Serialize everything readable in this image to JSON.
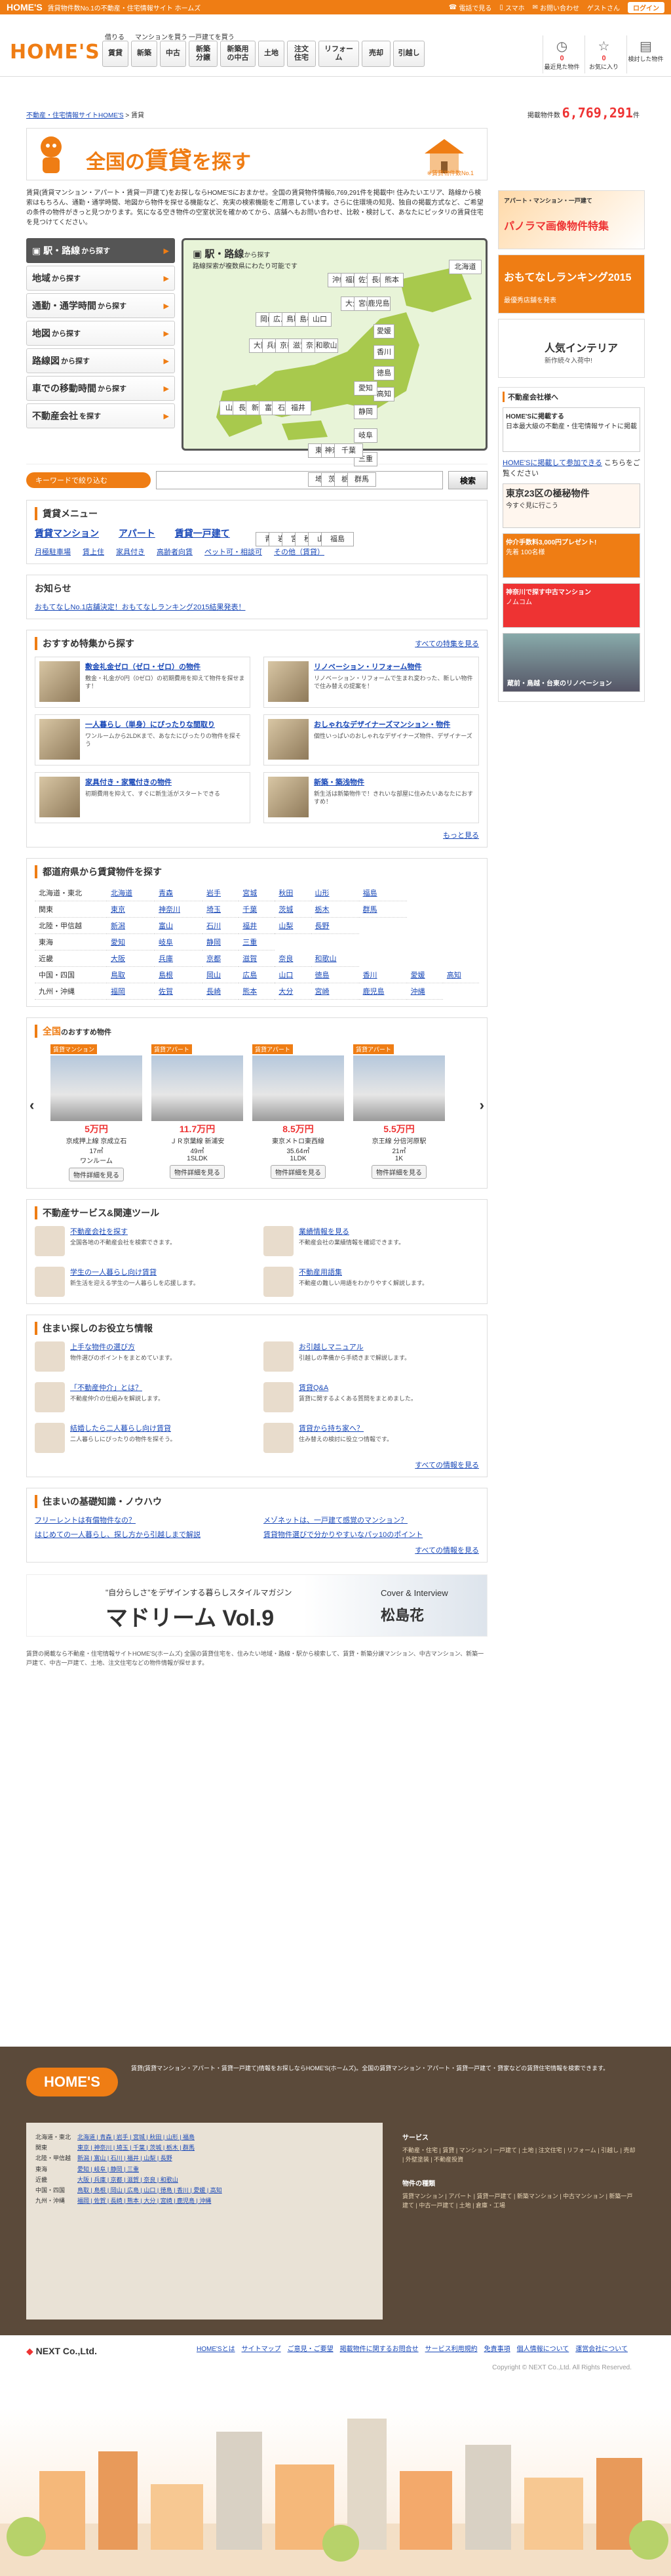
{
  "topbar": {
    "brand": "HOME'S",
    "tagline": "賃貸物件数No.1の不動産・住宅情報サイト ホームズ",
    "links": [
      "電話で見る",
      "スマホ",
      "お問い合わせ",
      "ゲストさん"
    ],
    "login": "ログイン"
  },
  "header": {
    "logo": "HOME'S",
    "group_rent": "借りる",
    "group_buy_mansion": "マンションを買う",
    "group_buy_house": "一戸建てを買う",
    "nav": [
      "賃貸",
      "新築",
      "中古",
      "新築分譲",
      "新築用の中古",
      "土地",
      "注文住宅",
      "リフォーム",
      "売却",
      "引越し"
    ],
    "icons": [
      {
        "icon": "clock-icon",
        "count": "0",
        "label": "最近見た物件"
      },
      {
        "icon": "star-icon",
        "count": "0",
        "label": "お気に入り"
      },
      {
        "icon": "memo-icon",
        "count": "",
        "label": "検討した物件"
      }
    ]
  },
  "breadcrumb": [
    "不動産・住宅情報サイトHOME'S",
    "賃貸"
  ],
  "counter": {
    "label": "掲載物件数",
    "value": "6,769,291",
    "unit": "件"
  },
  "hero": {
    "title_a": "全国の",
    "title_b": "賃貸",
    "title_c": "を探す",
    "caption": "※賃貸物件数No.1"
  },
  "intro": "賃貸(賃貸マンション・アパート・賃貸一戸建て)をお探しならHOME'Sにおまかせ。全国の賃貸物件情報6,769,291件を掲載中! 住みたいエリア、路線から検索はもちろん、通勤・通学時間、地図から物件を探せる機能など、充実の検索機能をご用意しています。さらに住環境の知見、独自の掲載方式など、ご希望の条件の物件がきっと見つかります。気になる空き物件の空室状況を確かめてから、店舗へもお問い合わせ、比較・検討して、あなたにピッタリの賃貸住宅を見つけてください。",
  "search_menu": [
    {
      "label": "駅・路線",
      "suffix": "から探す",
      "active": true
    },
    {
      "label": "地域",
      "suffix": "から探す"
    },
    {
      "label": "通勤・通学時間",
      "suffix": "から探す"
    },
    {
      "label": "地図",
      "suffix": "から探す"
    },
    {
      "label": "路線図",
      "suffix": "から探す"
    },
    {
      "label": "車での移動時間",
      "suffix": "から探す"
    },
    {
      "label": "不動産会社",
      "suffix": "を探す"
    }
  ],
  "map": {
    "title_a": "駅・路線",
    "title_b": "から探す",
    "subtitle": "路線探索が複数県にわたり可能です",
    "region_hokkaido": "北海道",
    "prefs": [
      {
        "name": "沖縄"
      },
      {
        "name": "福岡"
      },
      {
        "name": "佐賀"
      },
      {
        "name": "長崎"
      },
      {
        "name": "熊本"
      },
      {
        "name": "大分"
      },
      {
        "name": "宮崎"
      },
      {
        "name": "鹿児島"
      },
      {
        "name": "岡山"
      },
      {
        "name": "広島"
      },
      {
        "name": "鳥取"
      },
      {
        "name": "島根"
      },
      {
        "name": "山口"
      },
      {
        "name": "大阪"
      },
      {
        "name": "兵庫"
      },
      {
        "name": "京都"
      },
      {
        "name": "滋賀"
      },
      {
        "name": "奈良"
      },
      {
        "name": "和歌山"
      },
      {
        "name": "愛媛"
      },
      {
        "name": "香川"
      },
      {
        "name": "徳島"
      },
      {
        "name": "高知"
      },
      {
        "name": "山梨"
      },
      {
        "name": "長野"
      },
      {
        "name": "新潟"
      },
      {
        "name": "富山"
      },
      {
        "name": "石川"
      },
      {
        "name": "福井"
      },
      {
        "name": "愛知"
      },
      {
        "name": "静岡"
      },
      {
        "name": "岐阜"
      },
      {
        "name": "三重"
      },
      {
        "name": "東京"
      },
      {
        "name": "神奈川"
      },
      {
        "name": "千葉"
      },
      {
        "name": "埼玉"
      },
      {
        "name": "茨城"
      },
      {
        "name": "栃木"
      },
      {
        "name": "群馬"
      },
      {
        "name": "青森"
      },
      {
        "name": "岩手"
      },
      {
        "name": "宮城"
      },
      {
        "name": "秋田"
      },
      {
        "name": "山形"
      },
      {
        "name": "福島"
      }
    ]
  },
  "keyword": {
    "badge": "キーワードで絞り込む",
    "placeholder": "",
    "button": "検索"
  },
  "rent_menu": {
    "title": "賃貸メニュー",
    "main": [
      "賃貸マンション",
      "アパート",
      "賃貸一戸建て"
    ],
    "sub": [
      "月極駐車場",
      "賃上住",
      "家具付き",
      "高齢者向賃",
      "ペット可・相談可",
      "その他（賃貸）"
    ]
  },
  "notice": {
    "title": "お知らせ",
    "text": "おもてなしNo.1店舗決定！おもてなしランキング2015結果発表！"
  },
  "features": {
    "title": "おすすめ特集から探す",
    "all_link": "すべての特集を見る",
    "items": [
      {
        "title": "敷金礼金ゼロ（ゼロ・ゼロ）の物件",
        "desc": "敷金・礼金が0円（0ゼロ）の初期費用を抑えて物件を探せます！"
      },
      {
        "title": "リノベーション・リフォーム物件",
        "desc": "リノベーション・リフォームで生まれ変わった、新しい物件で住み替えの提案を！"
      },
      {
        "title": "一人暮らし（単身）にぴったりな間取り",
        "desc": "ワンルームから2LDKまで、あなたにぴったりの物件を探そう"
      },
      {
        "title": "おしゃれなデザイナーズマンション・物件",
        "desc": "個性いっぱいのおしゃれなデザイナーズ物件、デザイナーズ"
      },
      {
        "title": "家具付き・家電付きの物件",
        "desc": "初期費用を抑えて、すぐに新生活がスタートできる"
      },
      {
        "title": "新築・築浅物件",
        "desc": "新生活は新築物件で！きれいな部屋に住みたいあなたにおすすめ！"
      }
    ],
    "more": "もっと見る"
  },
  "by_pref": {
    "title": "都道府県から賃貸物件を探す",
    "rows": [
      {
        "region": "北海道・東北",
        "prefs": [
          "北海道",
          "青森",
          "岩手",
          "宮城",
          "秋田",
          "山形",
          "福島"
        ]
      },
      {
        "region": "関東",
        "prefs": [
          "東京",
          "神奈川",
          "埼玉",
          "千葉",
          "茨城",
          "栃木",
          "群馬"
        ]
      },
      {
        "region": "北陸・甲信越",
        "prefs": [
          "新潟",
          "富山",
          "石川",
          "福井",
          "山梨",
          "長野"
        ]
      },
      {
        "region": "東海",
        "prefs": [
          "愛知",
          "岐阜",
          "静岡",
          "三重"
        ]
      },
      {
        "region": "近畿",
        "prefs": [
          "大阪",
          "兵庫",
          "京都",
          "滋賀",
          "奈良",
          "和歌山"
        ]
      },
      {
        "region": "中国・四国",
        "prefs": [
          "鳥取",
          "島根",
          "岡山",
          "広島",
          "山口",
          "徳島",
          "香川",
          "愛媛",
          "高知"
        ]
      },
      {
        "region": "九州・沖縄",
        "prefs": [
          "福岡",
          "佐賀",
          "長崎",
          "熊本",
          "大分",
          "宮崎",
          "鹿児島",
          "沖縄"
        ]
      }
    ]
  },
  "recommend": {
    "title_a": "全国",
    "title_b": "のおすすめ物件",
    "cards": [
      {
        "tag": "賃貸マンション",
        "price": "5万円",
        "name": "京成押上線 京成立石",
        "detail": "17㎡",
        "layout": "ワンルーム",
        "btn": "物件詳細を見る"
      },
      {
        "tag": "賃貸アパート",
        "price": "11.7万円",
        "name": "ＪＲ京葉線 新浦安",
        "detail": "49㎡",
        "layout": "1SLDK",
        "btn": "物件詳細を見る"
      },
      {
        "tag": "賃貸アパート",
        "price": "8.5万円",
        "name": "東京メトロ東西線",
        "detail": "35.64㎡",
        "layout": "1LDK",
        "btn": "物件詳細を見る"
      },
      {
        "tag": "賃貸アパート",
        "price": "5.5万円",
        "name": "京王線 分倍河原駅",
        "detail": "21㎡",
        "layout": "1K",
        "btn": "物件詳細を見る"
      }
    ]
  },
  "services": {
    "title": "不動産サービス&関連ツール",
    "items": [
      {
        "title": "不動産会社を探す",
        "desc": "全国各地の不動産会社を検索できます。"
      },
      {
        "title": "業績情報を見る",
        "desc": "不動産会社の業績情報を確認できます。"
      },
      {
        "title": "学生の一人暮らし向け賃貸",
        "desc": "新生活を迎える学生の一人暮らしを応援します。"
      },
      {
        "title": "不動産用語集",
        "desc": "不動産の難しい用語をわかりやすく解説します。"
      }
    ]
  },
  "living_info": {
    "title": "住まい探しのお役立ち情報",
    "items": [
      {
        "title": "上手な物件の選び方",
        "desc": "物件選びのポイントをまとめています。"
      },
      {
        "title": "お引越しマニュアル",
        "desc": "引越しの準備から手続きまで解説します。"
      },
      {
        "title": "「不動産仲介」とは？",
        "desc": "不動産仲介の仕組みを解説します。"
      },
      {
        "title": "賃貸Q&A",
        "desc": "賃貸に関するよくある質問をまとめました。"
      },
      {
        "title": "結婚したら二人暮らし向け賃貸",
        "desc": "二人暮らしにぴったりの物件を探そう。"
      },
      {
        "title": "賃貸から持ち家へ？",
        "desc": "住み替えの検討に役立つ情報です。"
      }
    ],
    "all": "すべての情報を見る"
  },
  "basics": {
    "title": "住まいの基礎知識・ノウハウ",
    "items": [
      "フリーレントは有償物件なの？",
      "メゾネットは、一戸建て感覚のマンション？",
      "はじめての一人暮らし、探し方から引越しまで解説",
      "賃貸物件選びで分かりやすいなパッ10のポイント"
    ],
    "all": "すべての情報を見る"
  },
  "banner": {
    "catch": "\"自分らしさ\"をデザインする暮らしスタイルマガジン",
    "name": "マドリーム Vol.9",
    "cover": "Cover & Interview",
    "person": "松島花"
  },
  "disclaimer": "賃貸の掲載なら不動産・住宅情報サイトHOME'S(ホームズ) 全国の賃貸住宅を、住みたい地域・路線・駅から検索して、賃貸・新築分譲マンション、中古マンション、新築一戸建て、中古一戸建て、土地、注文住宅などの物件情報が探せます。",
  "sidebar": {
    "banners": [
      {
        "title": "パノラマ画像物件特集",
        "sub": "アパート・マンション・一戸建て"
      },
      {
        "title": "おもてなしランキング2015",
        "sub": "最優秀店舗を発表"
      },
      {
        "title": "人気インテリア",
        "sub": "新作続々入荷中!"
      }
    ],
    "company_box": {
      "title": "不動産会社様へ",
      "items": [
        {
          "title": "HOME'Sに掲載する",
          "sub": "日本最大級の不動産・住宅情報サイトに掲載"
        },
        {
          "title": "HOME'Sに掲載して参加できる",
          "sub": "こちらをご覧ください"
        },
        {
          "title": "東京23区の極秘物件",
          "sub": "今すぐ見に行こう"
        },
        {
          "title": "仲介手数料3,000円プレゼント!",
          "sub": "先着 100名様"
        },
        {
          "title": "神奈川で探す中古マンション",
          "sub": "ノムコム"
        },
        {
          "title": "蔵前・鳥越・台東のリノベーション",
          "sub": ""
        }
      ]
    }
  },
  "footer": {
    "logo": "HOME'S",
    "desc": "賃貸(賃貸マンション・アパート・賃貸一戸建て)情報をお探しならHOME'S(ホームズ)。全国の賃貸マンション・アパート・賃貸一戸建て・貸家などの賃貸住宅情報を検索できます。",
    "pref_rows": [
      {
        "region": "北海道・東北",
        "links": "北海道 | 青森 | 岩手 | 宮城 | 秋田 | 山形 | 福島"
      },
      {
        "region": "関東",
        "links": "東京 | 神奈川 | 埼玉 | 千葉 | 茨城 | 栃木 | 群馬"
      },
      {
        "region": "北陸・甲信越",
        "links": "新潟 | 富山 | 石川 | 福井 | 山梨 | 長野"
      },
      {
        "region": "東海",
        "links": "愛知 | 岐阜 | 静岡 | 三重"
      },
      {
        "region": "近畿",
        "links": "大阪 | 兵庫 | 京都 | 滋賀 | 奈良 | 和歌山"
      },
      {
        "region": "中国・四国",
        "links": "鳥取 | 島根 | 岡山 | 広島 | 山口 | 徳島 | 香川 | 愛媛 | 高知"
      },
      {
        "region": "九州・沖縄",
        "links": "福岡 | 佐賀 | 長崎 | 熊本 | 大分 | 宮崎 | 鹿児島 | 沖縄"
      }
    ],
    "service_head": "サービス",
    "service_links": "不動産・住宅 | 賃貸 | マンション | 一戸建て | 土地 | 注文住宅 | リフォーム | 引越し | 売却 | 外壁塗装 | 不動産投資",
    "kind_head": "物件の種類",
    "kind_links": "賃貸マンション | アパート | 賃貸一戸建て | 新築マンション | 中古マンション | 新築一戸建て | 中古一戸建て | 土地 | 倉庫・工場",
    "company": "NEXT Co.,Ltd.",
    "nav": [
      "HOME'Sとは",
      "サイトマップ",
      "ご意見・ご要望",
      "掲載物件に関するお問合せ",
      "サービス利用規約",
      "免責事項",
      "個人情報について",
      "運営会社について"
    ],
    "copyright": "Copyright © NEXT Co.,Ltd. All Rights Reserved."
  }
}
